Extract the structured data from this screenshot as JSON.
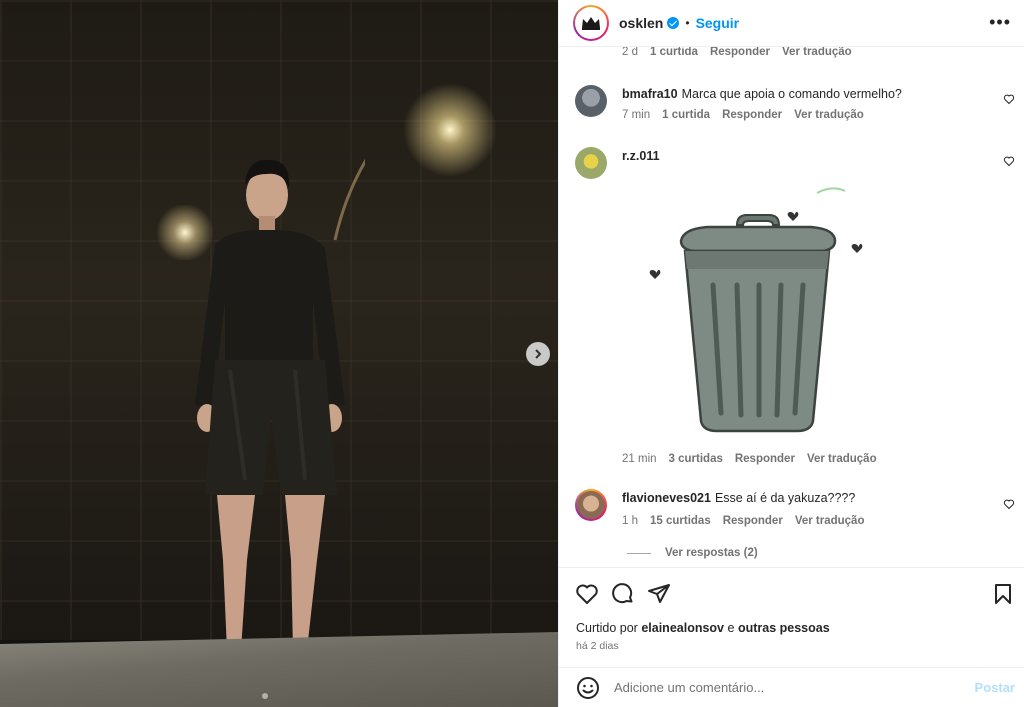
{
  "post": {
    "handle": "osklen",
    "follow_label": "Seguir",
    "separator": "•",
    "more_label": "•••"
  },
  "comments": [
    {
      "user": "",
      "text": "",
      "time": "2 d",
      "likes": "1 curtida",
      "reply": "Responder",
      "translate": "Ver tradução"
    },
    {
      "user": "bmafra10",
      "text": "Marca que apoia o comando vermelho?",
      "time": "7 min",
      "likes": "1 curtida",
      "reply": "Responder",
      "translate": "Ver tradução"
    },
    {
      "user": "r.z.011",
      "text": "",
      "sticker": "trash-can-sticker",
      "time": "21 min",
      "likes": "3 curtidas",
      "reply": "Responder",
      "translate": "Ver tradução"
    },
    {
      "user": "flavioneves021",
      "text": "Esse aí é da yakuza????",
      "time": "1 h",
      "likes": "15 curtidas",
      "reply": "Responder",
      "translate": "Ver tradução",
      "view_replies": "Ver respostas (2)"
    }
  ],
  "likes": {
    "prefix": "Curtido por",
    "user": "elainealonsov",
    "joiner": "e",
    "others": "outras pessoas",
    "posted": "há 2 dias"
  },
  "add_comment": {
    "placeholder": "Adicione um comentário...",
    "post_label": "Postar"
  },
  "colors": {
    "accent": "#0095f6",
    "muted": "#737373",
    "post_disabled": "#b2dffc"
  }
}
